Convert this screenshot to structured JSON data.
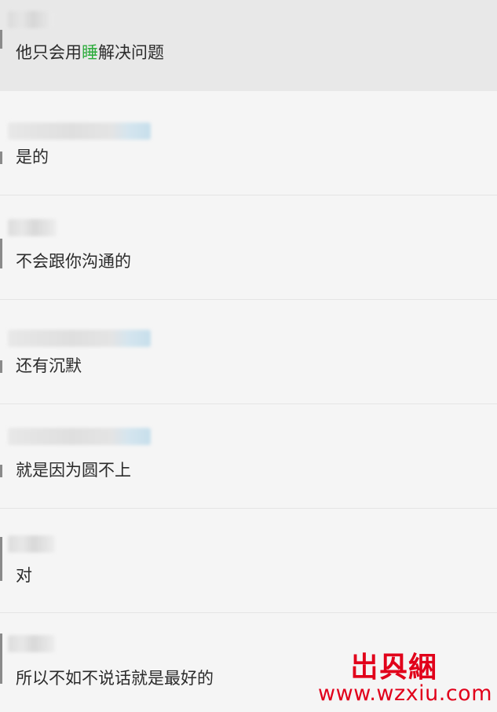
{
  "conversation": {
    "items": [
      {
        "message_before": "他只会用",
        "message_highlight": "睡",
        "message_after": "解决问题",
        "name_obscured": true,
        "selected": true
      },
      {
        "message": "是的",
        "name_obscured": true
      },
      {
        "message": "不会跟你沟通的",
        "name_obscured": true
      },
      {
        "message": "还有沉默",
        "name_obscured": true
      },
      {
        "message": "就是因为圆不上",
        "name_obscured": true
      },
      {
        "message": "对",
        "name_obscured": true
      },
      {
        "message": "所以不如不说话就是最好的",
        "name_obscured": true
      }
    ]
  },
  "watermark": {
    "logo_text": "岀㒷綑",
    "url": "www.wzxiu.com",
    "color": "#e1001a"
  },
  "colors": {
    "highlight": "#2cab3b",
    "selected_bg": "#e8e8e8",
    "bg": "#f5f5f5"
  }
}
